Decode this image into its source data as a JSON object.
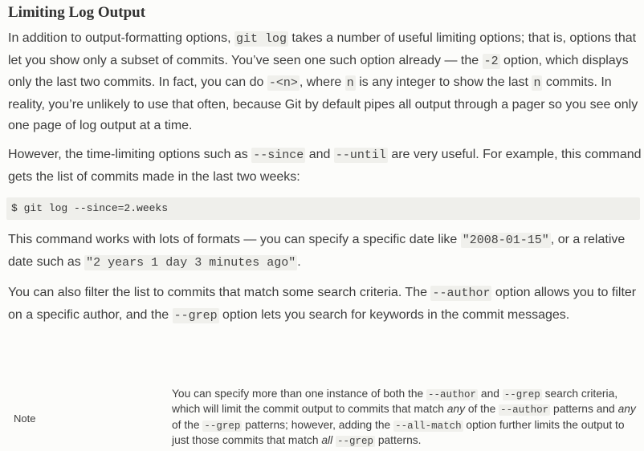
{
  "heading": "Limiting Log Output",
  "p1": {
    "t1": "In addition to output-formatting options, ",
    "c1": "git log",
    "t2": " takes a number of useful limiting options; that is, options that let you show only a subset of commits. You’ve seen one such option already — the ",
    "c2": "-2",
    "t3": " option, which displays only the last two commits. In fact, you can do ",
    "c3": "-<n>",
    "t4": ", where ",
    "c4": "n",
    "t5": " is any integer to show the last ",
    "c5": "n",
    "t6": " commits. In reality, you’re unlikely to use that often, because Git by default pipes all output through a pager so you see only one page of log output at a time."
  },
  "p2": {
    "t1": "However, the time-limiting options such as ",
    "c1": "--since",
    "t2": " and ",
    "c2": "--until",
    "t3": " are very useful. For example, this command gets the list of commits made in the last two weeks:"
  },
  "code_block": "$ git log --since=2.weeks",
  "p3": {
    "t1": "This command works with lots of formats — you can specify a specific date like ",
    "c1": "\"2008-01-15\"",
    "t2": ", or a relative date such as ",
    "c2": "\"2 years 1 day 3 minutes ago\"",
    "t3": "."
  },
  "p4": {
    "t1": "You can also filter the list to commits that match some search criteria. The ",
    "c1": "--author",
    "t2": " option allows you to filter on a specific author, and the ",
    "c2": "--grep",
    "t3": " option lets you search for keywords in the commit messages."
  },
  "note": {
    "label": "Note",
    "t1": "You can specify more than one instance of both the ",
    "c1": "--author",
    "t2": " and ",
    "c2": "--grep",
    "t3": " search criteria, which will limit the commit output to commits that match ",
    "e1": "any",
    "t4": " of the ",
    "c3": "--author",
    "t5": " patterns and ",
    "e2": "any",
    "t6": " of the ",
    "c4": "--grep",
    "t7": " patterns; however, adding the ",
    "c5": "--all-match",
    "t8": " option further limits the output to just those commits that match ",
    "e3": "all",
    "t9": " ",
    "c6": "--grep",
    "t10": " patterns."
  }
}
